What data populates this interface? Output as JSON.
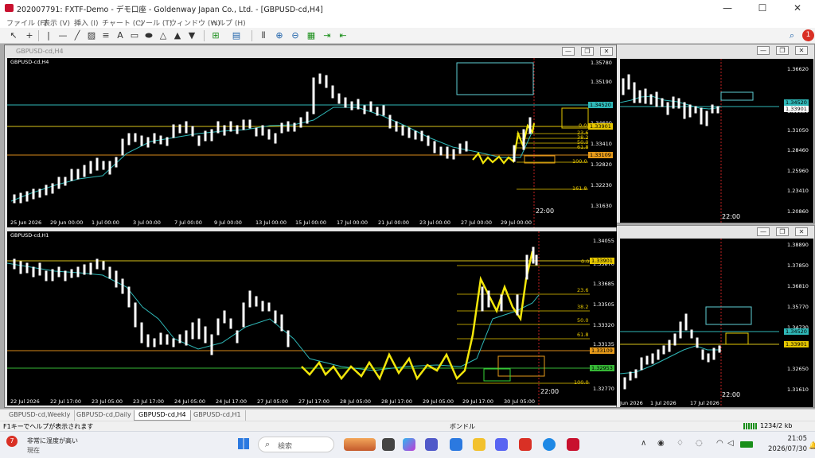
{
  "window": {
    "title": "202007791: FXTF-Demo - デモ口座 - Goldenway Japan Co., Ltd. - [GBPUSD-cd,H4]",
    "controls": [
      "—",
      "☐",
      "✕"
    ]
  },
  "menu": [
    "ファイル (F)",
    "表示 (V)",
    "挿入 (I)",
    "チャート (C)",
    "ツール (T)",
    "ウィンドウ (W)",
    "ヘルプ (H)"
  ],
  "toolbar": {
    "notification_count": "1"
  },
  "charts": {
    "h4": {
      "caption": "GBPUSD-cd,H4",
      "symbol": "GBPUSD-cd,H4",
      "prices": [
        "1.35780",
        "1.35190",
        "1.34600",
        "1.34010",
        "1.33410",
        "1.32820",
        "1.32230",
        "1.31630"
      ],
      "price_boxes": {
        "teal": "1.34520",
        "yellow": "1.33901",
        "orange": "1.33109"
      },
      "fib_labels": [
        "0.0",
        "23.6",
        "38.2",
        "50.0",
        "61.8",
        "100.0",
        "161.8"
      ],
      "dates": [
        "25 Jun 2026",
        "29 Jun 00:00",
        "1 Jul 00:00",
        "3 Jul 00:00",
        "7 Jul 00:00",
        "9 Jul 00:00",
        "13 Jul 00:00",
        "15 Jul 00:00",
        "17 Jul 00:00",
        "21 Jul 00:00",
        "23 Jul 00:00",
        "27 Jul 00:00",
        "29 Jul 00:00"
      ],
      "clock": "22:00"
    },
    "h1": {
      "symbol": "GBPUSD-cd,H1",
      "prices": [
        "1.34055",
        "1.33870",
        "1.33685",
        "1.33505",
        "1.33320",
        "1.33135",
        "1.32950",
        "1.32770"
      ],
      "price_boxes": {
        "yellow": "1.33901",
        "orange": "1.33109",
        "green": "1.32953"
      },
      "fib_labels": [
        "0.0",
        "23.6",
        "38.2",
        "50.0",
        "61.8",
        "100.0"
      ],
      "dates": [
        "22 Jul 2026",
        "22 Jul 17:00",
        "23 Jul 05:00",
        "23 Jul 17:00",
        "24 Jul 05:00",
        "24 Jul 17:00",
        "27 Jul 05:00",
        "27 Jul 17:00",
        "28 Jul 05:00",
        "28 Jul 17:00",
        "29 Jul 05:00",
        "29 Jul 17:00",
        "30 Jul 05:00"
      ],
      "clock": "22:00"
    },
    "daily": {
      "prices": [
        "1.36620",
        "1.33650",
        "1.31050",
        "1.28460",
        "1.25960",
        "1.23410",
        "1.20860"
      ],
      "price_boxes": {
        "teal": "1.34520",
        "cyan": "1.33901"
      },
      "clock": "22:00"
    },
    "weekly": {
      "prices": [
        "1.38890",
        "1.37850",
        "1.36810",
        "1.35770",
        "1.34730",
        "1.32650",
        "1.31610"
      ],
      "price_boxes": {
        "teal": "1.34520",
        "yellow": "1.33901"
      },
      "dates": [
        "Jun 2026",
        "1 Jul 2026",
        "17 Jul 2026"
      ],
      "clock": "22:00"
    }
  },
  "tabs": [
    "GBPUSD-cd,Weekly",
    "GBPUSD-cd,Daily",
    "GBPUSD-cd,H4",
    "GBPUSD-cd,H1"
  ],
  "status": {
    "help": "F1キーでヘルプが表示されます",
    "profile": "ボンドル",
    "traffic": "1234/2 kb"
  },
  "taskbar": {
    "weather_badge": "7",
    "weather_line1": "非常に湿度が高い",
    "weather_line2": "現在",
    "search_placeholder": "検索",
    "time": "21:05",
    "date": "2026/07/30"
  }
}
